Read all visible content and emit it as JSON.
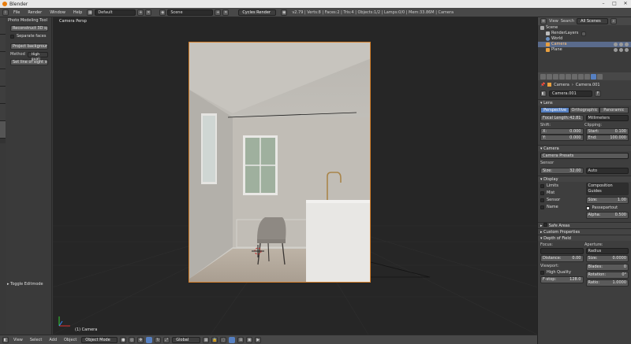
{
  "window": {
    "title": "Blender"
  },
  "info_header": {
    "menus": [
      "File",
      "Render",
      "Window",
      "Help"
    ],
    "screen_layout": "Default",
    "scene": "Scene",
    "engine": "Cycles Render",
    "stats": "v2.79 | Verts:8 | Faces:2 | Tris:4 | Objects:1/2 | Lamps:0/0 | Mem:33.86M | Camera"
  },
  "tool_shelf": {
    "header": "Photo Modeling Tool",
    "buttons": [
      "Reconstruct 3D sp...",
      "Project backgroun...",
      "Set line of sight scal..."
    ],
    "separate_faces": "Separate faces",
    "method_label": "Method",
    "method_value": "High quali",
    "toggle_editmode": "Toggle Editmode"
  },
  "viewport": {
    "label": "Camera Persp",
    "object_label": "(1) Camera"
  },
  "bottom_header": {
    "menus": [
      "View",
      "Select",
      "Add",
      "Object"
    ],
    "mode": "Object Mode",
    "orientation": "Global"
  },
  "outliner": {
    "menus": [
      "View",
      "Search"
    ],
    "filter": "All Scenes",
    "items": [
      "Scene",
      "RenderLayers",
      "World",
      "Camera",
      "Plane"
    ]
  },
  "properties": {
    "breadcrumb": [
      "Camera",
      "Camera.001"
    ],
    "datablock": "Camera.001",
    "datablock_flag": "F",
    "lens_panel": "Lens",
    "projection": [
      "Perspective",
      "Orthographic",
      "Panoramic"
    ],
    "focal_length_label": "Focal Length:",
    "focal_length": "42.81",
    "units": "Millimeters",
    "shift_label": "Shift:",
    "clipping_label": "Clipping:",
    "shift_x_label": "X:",
    "shift_x": "0.000",
    "shift_y_label": "Y:",
    "shift_y": "0.000",
    "clip_start_label": "Start:",
    "clip_start": "0.100",
    "clip_end_label": "End:",
    "clip_end": "100.000",
    "camera_panel": "Camera",
    "presets": "Camera Presets",
    "sensor_label": "Sensor",
    "size_label": "Size:",
    "sensor_size": "32.00",
    "sensor_fit": "Auto",
    "display_panel": "Display",
    "display_checks": [
      "Limits",
      "Mist",
      "Sensor",
      "Name"
    ],
    "composition": "Composition Guides",
    "display_size": "1.00",
    "passepartout": "Passepartout",
    "alpha_label": "Alpha:",
    "alpha": "0.500",
    "safe_areas": "Safe Areas",
    "custom_properties": "Custom Properties",
    "dof_panel": "Depth of Field",
    "focus_label": "Focus:",
    "aperture_label": "Aperture:",
    "aperture_type": "Radius",
    "distance_label": "Distance:",
    "distance": "0.00",
    "ap_size": "0.0000",
    "viewport_label": "Viewport:",
    "blades_label": "Blades:",
    "blades": "0",
    "high_quality": "High Quality",
    "rotation_label": "Rotation:",
    "rotation": "0°",
    "fstop_label": "F-stop:",
    "fstop": "128.0",
    "ratio_label": "Ratio:",
    "ratio": "1.0000"
  }
}
